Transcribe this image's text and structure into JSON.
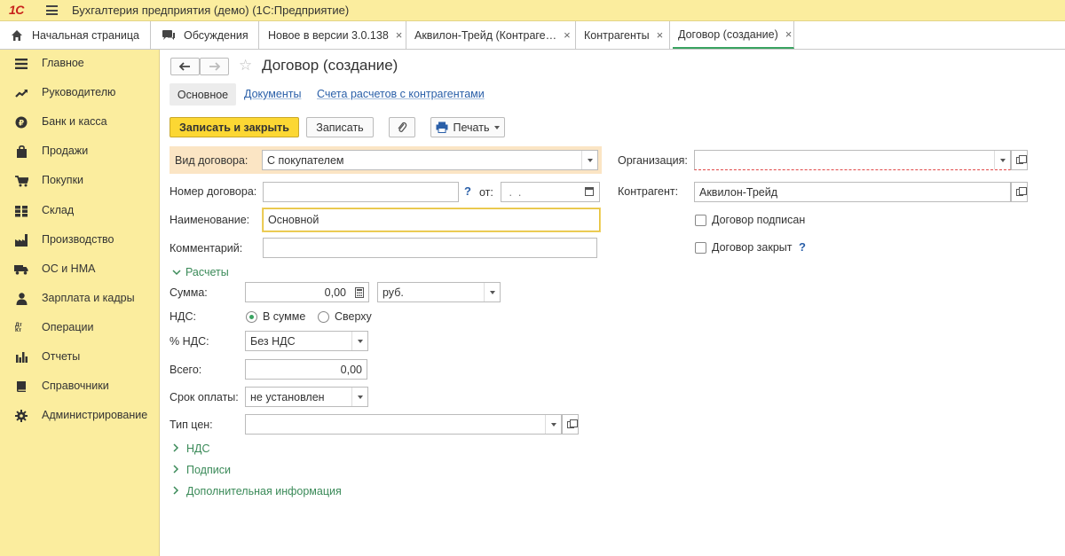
{
  "app": {
    "logo": "1С",
    "title": "Бухгалтерия предприятия (демо)  (1С:Предприятие)"
  },
  "tabs": [
    {
      "label": "Начальная страница",
      "icon": "home-icon"
    },
    {
      "label": "Обсуждения",
      "icon": "chat-icon"
    },
    {
      "label": "Новое в версии 3.0.138",
      "close": "×"
    },
    {
      "label": "Аквилон-Трейд (Контраге…",
      "close": "×"
    },
    {
      "label": "Контрагенты",
      "close": "×"
    },
    {
      "label": "Договор (создание)",
      "close": "×"
    }
  ],
  "sidebar": {
    "items": [
      {
        "label": "Главное",
        "icon": "menu-icon"
      },
      {
        "label": "Руководителю",
        "icon": "trend-icon"
      },
      {
        "label": "Банк и касса",
        "icon": "coin-icon"
      },
      {
        "label": "Продажи",
        "icon": "bag-icon"
      },
      {
        "label": "Покупки",
        "icon": "cart-icon"
      },
      {
        "label": "Склад",
        "icon": "warehouse-icon"
      },
      {
        "label": "Производство",
        "icon": "factory-icon"
      },
      {
        "label": "ОС и НМА",
        "icon": "truck-icon"
      },
      {
        "label": "Зарплата и кадры",
        "icon": "person-icon"
      },
      {
        "label": "Операции",
        "icon": "dt-kt-icon"
      },
      {
        "label": "Отчеты",
        "icon": "bar-chart-icon"
      },
      {
        "label": "Справочники",
        "icon": "book-icon"
      },
      {
        "label": "Администрирование",
        "icon": "gear-icon"
      }
    ],
    "operations_icon_text": "Дт Кт"
  },
  "form": {
    "title": "Договор (создание)",
    "subtabs": {
      "main": "Основное",
      "documents": "Документы",
      "accounts": "Счета расчетов с контрагентами"
    },
    "toolbar": {
      "save_close": "Записать и закрыть",
      "save": "Записать",
      "print": "Печать"
    },
    "fields": {
      "contract_type_label": "Вид договора:",
      "contract_type_value": "С покупателем",
      "number_label": "Номер договора:",
      "number_value": "",
      "from_label": "от:",
      "date_value": " .  .",
      "name_label": "Наименование:",
      "name_value": "Основной",
      "comment_label": "Комментарий:",
      "comment_value": "",
      "organization_label": "Организация:",
      "organization_value": "",
      "counterparty_label": "Контрагент:",
      "counterparty_value": "Аквилон-Трейд",
      "signed_label": "Договор подписан",
      "closed_label": "Договор закрыт",
      "help": "?"
    },
    "settlements": {
      "group_label": "Расчеты",
      "sum_label": "Сумма:",
      "sum_value": "0,00",
      "currency_value": "руб.",
      "vat_label": "НДС:",
      "vat_in_sum": "В сумме",
      "vat_on_top": "Сверху",
      "vat_rate_label": "% НДС:",
      "vat_rate_value": "Без НДС",
      "total_label": "Всего:",
      "total_value": "0,00",
      "payment_term_label": "Срок оплаты:",
      "payment_term_value": "не установлен",
      "price_type_label": "Тип цен:",
      "price_type_value": ""
    },
    "groups": {
      "vat": "НДС",
      "signatures": "Подписи",
      "additional": "Дополнительная информация"
    }
  },
  "colors": {
    "accent_yellow": "#fcd733",
    "panel_yellow": "#fbed9e",
    "link_blue": "#2a5fa8",
    "group_green": "#3a8a58",
    "active_tab_green": "#3aa361",
    "error_red": "#e14848"
  }
}
